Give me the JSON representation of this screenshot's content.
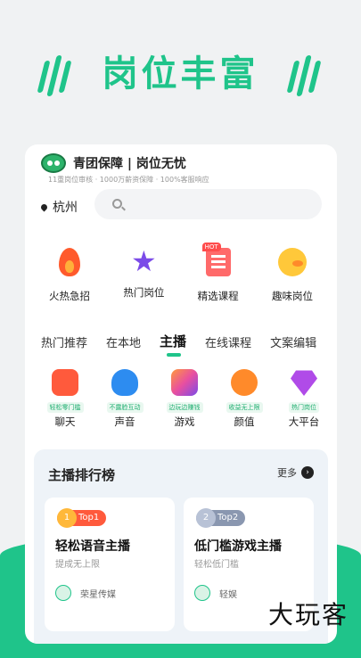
{
  "hero": {
    "title": "岗位丰富"
  },
  "brand": {
    "title": "青团保障 | 岗位无忧",
    "subtitle": "11重岗位审核 · 1000万薪资保障 · 100%客服响应"
  },
  "location": {
    "city": "杭州"
  },
  "search": {
    "placeholder": ""
  },
  "categories": [
    {
      "label": "火热急招",
      "icon": "fire-icon"
    },
    {
      "label": "热门岗位",
      "icon": "star-icon"
    },
    {
      "label": "精选课程",
      "icon": "document-icon",
      "badge": "HOT"
    },
    {
      "label": "趣味岗位",
      "icon": "duck-icon"
    }
  ],
  "tabs": [
    "热门推荐",
    "在本地",
    "主播",
    "在线课程",
    "文案编辑"
  ],
  "active_tab": "主播",
  "subcategories": [
    {
      "tag": "轻松零门槛",
      "label": "聊天",
      "icon": "chat-icon",
      "color": "#ff5a3c"
    },
    {
      "tag": "不露脸互动",
      "label": "声音",
      "icon": "balloon-icon",
      "color": "#2d8cf0"
    },
    {
      "tag": "边玩边赚钱",
      "label": "游戏",
      "icon": "game-icon",
      "color": "#e84fa0"
    },
    {
      "tag": "收益无上限",
      "label": "颜值",
      "icon": "face-icon",
      "color": "#ff8a2a"
    },
    {
      "tag": "热门岗位",
      "label": "大平台",
      "icon": "diamond-icon",
      "color": "#b04be8"
    }
  ],
  "ranking": {
    "title": "主播排行榜",
    "more": "更多",
    "cards": [
      {
        "rank": "1",
        "badge": "Top1",
        "title": "轻松语音主播",
        "subtitle": "提成无上限",
        "company": "荣星传媒",
        "badge_color": "#ff5a3c",
        "num_color": "#ffb83a"
      },
      {
        "rank": "2",
        "badge": "Top2",
        "title": "低门槛游戏主播",
        "subtitle": "轻松低门槛",
        "company": "轻娱",
        "badge_color": "#8a97b0",
        "num_color": "#b8c2d6"
      }
    ]
  },
  "watermark": "大玩客"
}
